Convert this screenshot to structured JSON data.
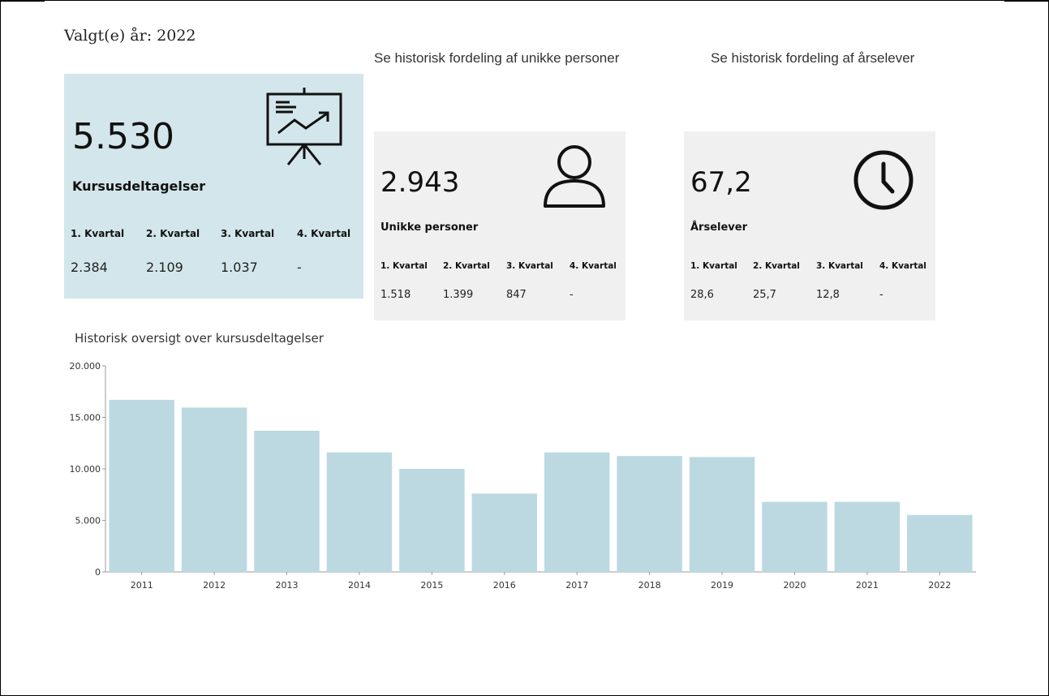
{
  "header": {
    "selected_year_label": "Valgt(e) år: 2022",
    "link_unique_persons": "Se historisk fordeling af unikke personer",
    "link_yearly_students": "Se historisk fordeling af årselever"
  },
  "kpi_main": {
    "value": "5.530",
    "label": "Kursusdeltagelser",
    "icon": "presentation-chart-icon",
    "background": "#d3e6eb",
    "quarters": [
      {
        "head": "1. Kvartal",
        "value": "2.384"
      },
      {
        "head": "2. Kvartal",
        "value": "2.109"
      },
      {
        "head": "3. Kvartal",
        "value": "1.037"
      },
      {
        "head": "4. Kvartal",
        "value": "-"
      }
    ]
  },
  "kpi_unique": {
    "value": "2.943",
    "label": "Unikke personer",
    "icon": "person-icon",
    "background": "#f0f0f0",
    "quarters": [
      {
        "head": "1. Kvartal",
        "value": "1.518"
      },
      {
        "head": "2. Kvartal",
        "value": "1.399"
      },
      {
        "head": "3. Kvartal",
        "value": "847"
      },
      {
        "head": "4. Kvartal",
        "value": "-"
      }
    ]
  },
  "kpi_yearly": {
    "value": "67,2",
    "label": "Årselever",
    "icon": "clock-icon",
    "background": "#f0f0f0",
    "quarters": [
      {
        "head": "1. Kvartal",
        "value": "28,6"
      },
      {
        "head": "2. Kvartal",
        "value": "25,7"
      },
      {
        "head": "3. Kvartal",
        "value": "12,8"
      },
      {
        "head": "4. Kvartal",
        "value": "-"
      }
    ]
  },
  "chart_data": {
    "type": "bar",
    "title": "Historisk oversigt over kursusdeltagelser",
    "xlabel": "",
    "ylabel": "",
    "categories": [
      "2011",
      "2012",
      "2013",
      "2014",
      "2015",
      "2016",
      "2017",
      "2018",
      "2019",
      "2020",
      "2021",
      "2022"
    ],
    "values": [
      16700,
      15950,
      13700,
      11600,
      10000,
      7600,
      11600,
      11250,
      11150,
      6800,
      6800,
      5530
    ],
    "ylim": [
      0,
      20000
    ],
    "yticks": [
      0,
      5000,
      10000,
      15000,
      20000
    ],
    "ytick_labels": [
      "0",
      "5.000",
      "10.000",
      "15.000",
      "20.000"
    ],
    "grid": false,
    "legend": "none",
    "bar_color": "#bcd9e2"
  }
}
